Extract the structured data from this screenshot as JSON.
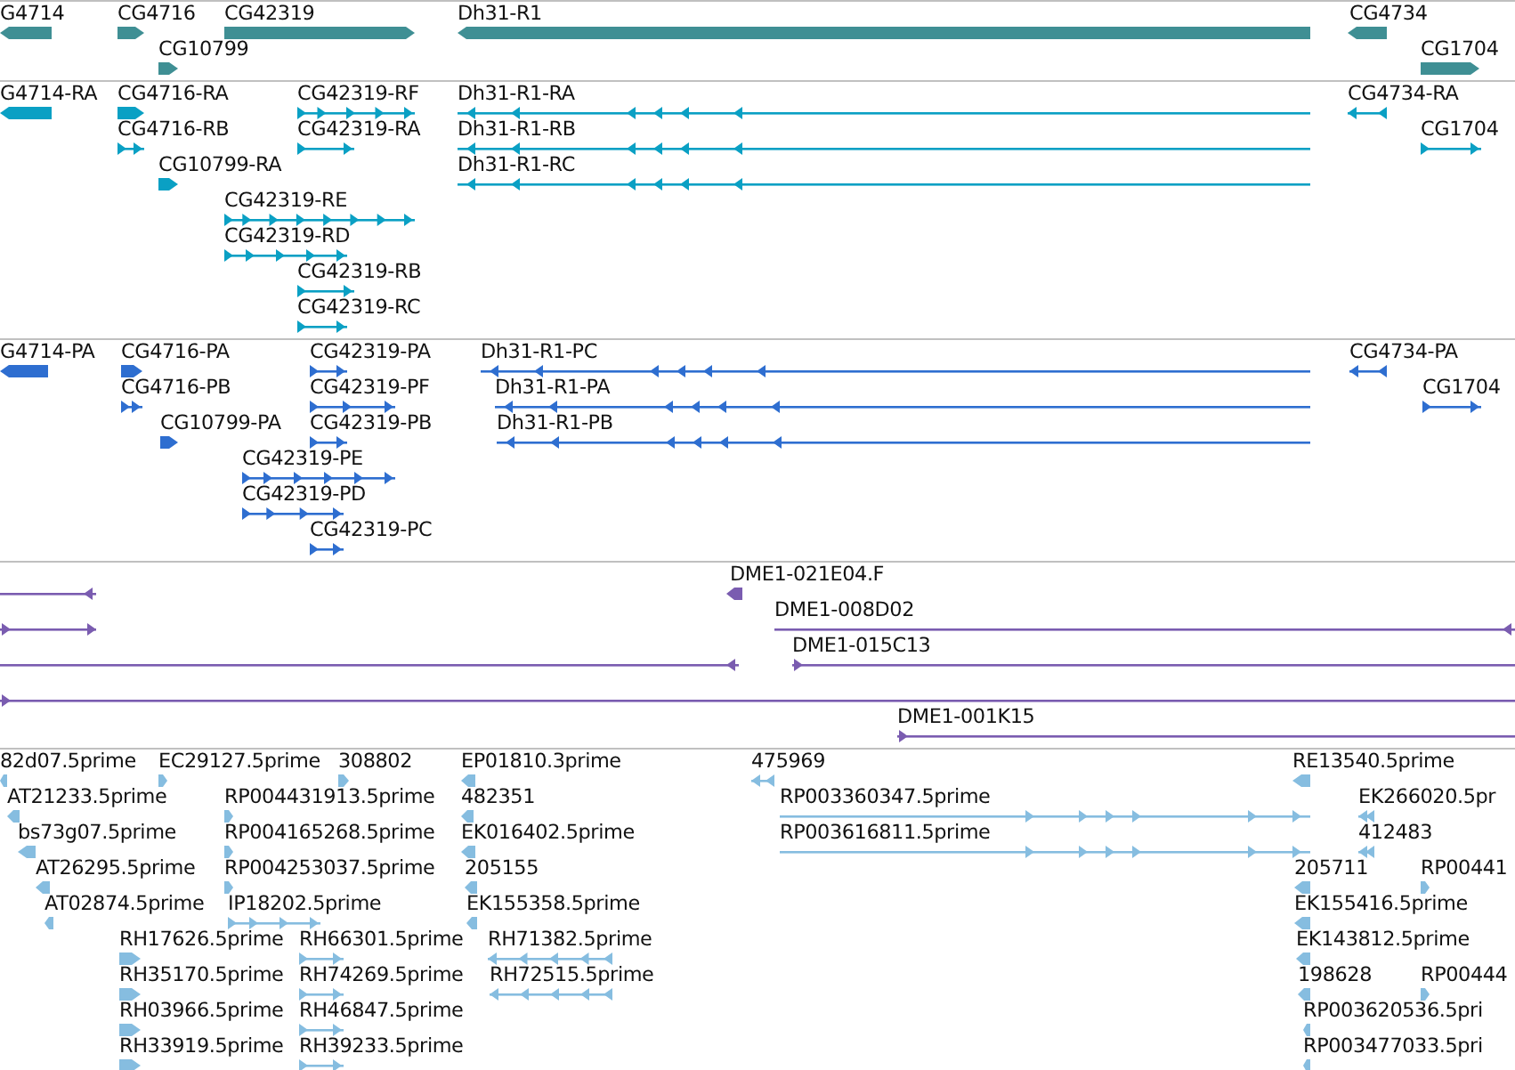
{
  "tracks": [
    {
      "color": "#3f8f94",
      "features": [
        {
          "label": "G4714",
          "kind": "block",
          "reverse": true
        },
        {
          "label": "CG4716",
          "kind": "block",
          "reverse": false
        },
        {
          "label": "CG42319",
          "kind": "block",
          "reverse": false
        },
        {
          "label": "Dh31-R1",
          "kind": "block",
          "reverse": true
        },
        {
          "label": "CG4734",
          "kind": "block",
          "reverse": true
        },
        {
          "label": "CG10799",
          "kind": "block",
          "reverse": false
        },
        {
          "label": "CG1704",
          "kind": "block",
          "reverse": false
        }
      ]
    },
    {
      "color": "#0aa0c4",
      "features": [
        {
          "label": "G4714-RA",
          "kind": "block",
          "reverse": true
        },
        {
          "label": "CG4716-RA",
          "kind": "block",
          "reverse": false
        },
        {
          "label": "CG42319-RF",
          "kind": "spliced",
          "reverse": false
        },
        {
          "label": "Dh31-R1-RA",
          "kind": "spliced",
          "reverse": true
        },
        {
          "label": "CG4734-RA",
          "kind": "spliced",
          "reverse": true
        },
        {
          "label": "CG4716-RB",
          "kind": "spliced",
          "reverse": false
        },
        {
          "label": "CG42319-RA",
          "kind": "spliced",
          "reverse": false
        },
        {
          "label": "Dh31-R1-RB",
          "kind": "spliced",
          "reverse": true
        },
        {
          "label": "CG1704",
          "kind": "spliced",
          "reverse": false
        },
        {
          "label": "CG10799-RA",
          "kind": "block",
          "reverse": false
        },
        {
          "label": "Dh31-R1-RC",
          "kind": "spliced",
          "reverse": true
        },
        {
          "label": "CG42319-RE",
          "kind": "spliced",
          "reverse": false
        },
        {
          "label": "CG42319-RD",
          "kind": "spliced",
          "reverse": false
        },
        {
          "label": "CG42319-RB",
          "kind": "spliced",
          "reverse": false
        },
        {
          "label": "CG42319-RC",
          "kind": "spliced",
          "reverse": false
        }
      ]
    },
    {
      "color": "#2e6ed0",
      "features": [
        {
          "label": "G4714-PA",
          "kind": "block",
          "reverse": true
        },
        {
          "label": "CG4716-PA",
          "kind": "block",
          "reverse": false
        },
        {
          "label": "CG42319-PA",
          "kind": "spliced",
          "reverse": false
        },
        {
          "label": "Dh31-R1-PC",
          "kind": "spliced",
          "reverse": true
        },
        {
          "label": "CG4734-PA",
          "kind": "spliced",
          "reverse": true
        },
        {
          "label": "CG4716-PB",
          "kind": "spliced",
          "reverse": false
        },
        {
          "label": "CG42319-PF",
          "kind": "spliced",
          "reverse": false
        },
        {
          "label": "Dh31-R1-PA",
          "kind": "spliced",
          "reverse": true
        },
        {
          "label": "CG1704",
          "kind": "spliced",
          "reverse": false
        },
        {
          "label": "CG10799-PA",
          "kind": "block",
          "reverse": false
        },
        {
          "label": "CG42319-PB",
          "kind": "spliced",
          "reverse": false
        },
        {
          "label": "Dh31-R1-PB",
          "kind": "spliced",
          "reverse": true
        },
        {
          "label": "CG42319-PE",
          "kind": "spliced",
          "reverse": false
        },
        {
          "label": "CG42319-PD",
          "kind": "spliced",
          "reverse": false
        },
        {
          "label": "CG42319-PC",
          "kind": "spliced",
          "reverse": false
        }
      ]
    },
    {
      "color": "#7a5cb0",
      "features": [
        {
          "kind": "clone",
          "reverse": true
        },
        {
          "label": "DME1-021E04.F",
          "kind": "block",
          "reverse": true
        },
        {
          "kind": "clone",
          "reverse": false
        },
        {
          "label": "DME1-008D02",
          "kind": "clone",
          "reverse": true
        },
        {
          "kind": "clone",
          "reverse": true
        },
        {
          "label": "DME1-015C13",
          "kind": "clone",
          "reverse": false
        },
        {
          "kind": "clone",
          "reverse": false
        },
        {
          "label": "DME1-001K15",
          "kind": "clone",
          "reverse": false
        }
      ]
    },
    {
      "color": "#86bde0",
      "features": [
        {
          "label": "82d07.5prime",
          "kind": "block",
          "reverse": true
        },
        {
          "label": "EC29127.5prime",
          "kind": "block",
          "reverse": false
        },
        {
          "label": "308802",
          "kind": "block",
          "reverse": false
        },
        {
          "label": "EP01810.3prime",
          "kind": "block",
          "reverse": true
        },
        {
          "label": "475969",
          "kind": "spliced",
          "reverse": true
        },
        {
          "label": "RE13540.5prime",
          "kind": "block",
          "reverse": true
        },
        {
          "label": "AT21233.5prime",
          "kind": "block",
          "reverse": true
        },
        {
          "label": "RP004431913.5prime",
          "kind": "block",
          "reverse": false
        },
        {
          "label": "482351",
          "kind": "block",
          "reverse": true
        },
        {
          "label": "RP003360347.5prime",
          "kind": "spliced",
          "reverse": false
        },
        {
          "label": "EK266020.5pr",
          "kind": "spliced",
          "reverse": true
        },
        {
          "label": "bs73g07.5prime",
          "kind": "block",
          "reverse": true
        },
        {
          "label": "RP004165268.5prime",
          "kind": "block",
          "reverse": false
        },
        {
          "label": "EK016402.5prime",
          "kind": "block",
          "reverse": true
        },
        {
          "label": "RP003616811.5prime",
          "kind": "spliced",
          "reverse": false
        },
        {
          "label": "412483",
          "kind": "spliced",
          "reverse": true
        },
        {
          "label": "AT26295.5prime",
          "kind": "block",
          "reverse": true
        },
        {
          "label": "RP004253037.5prime",
          "kind": "block",
          "reverse": false
        },
        {
          "label": "205155",
          "kind": "block",
          "reverse": true
        },
        {
          "label": "205711",
          "kind": "block",
          "reverse": true
        },
        {
          "label": "RP00441",
          "kind": "block",
          "reverse": false
        },
        {
          "label": "AT02874.5prime",
          "kind": "block",
          "reverse": true
        },
        {
          "label": "IP18202.5prime",
          "kind": "spliced",
          "reverse": false
        },
        {
          "label": "EK155358.5prime",
          "kind": "block",
          "reverse": true
        },
        {
          "label": "EK155416.5prime",
          "kind": "block",
          "reverse": true
        },
        {
          "label": "RH17626.5prime",
          "kind": "block",
          "reverse": false
        },
        {
          "label": "RH66301.5prime",
          "kind": "spliced",
          "reverse": false
        },
        {
          "label": "RH71382.5prime",
          "kind": "spliced",
          "reverse": true
        },
        {
          "label": "EK143812.5prime",
          "kind": "block",
          "reverse": true
        },
        {
          "label": "RH35170.5prime",
          "kind": "block",
          "reverse": false
        },
        {
          "label": "RH74269.5prime",
          "kind": "spliced",
          "reverse": false
        },
        {
          "label": "RH72515.5prime",
          "kind": "spliced",
          "reverse": true
        },
        {
          "label": "198628",
          "kind": "block",
          "reverse": true
        },
        {
          "label": "RP00444",
          "kind": "block",
          "reverse": false
        },
        {
          "label": "RH03966.5prime",
          "kind": "block",
          "reverse": false
        },
        {
          "label": "RH46847.5prime",
          "kind": "spliced",
          "reverse": false
        },
        {
          "label": "RP003620536.5pri",
          "kind": "block",
          "reverse": true
        },
        {
          "label": "RH33919.5prime",
          "kind": "block",
          "reverse": false
        },
        {
          "label": "RH39233.5prime",
          "kind": "spliced",
          "reverse": false
        },
        {
          "label": "RP003477033.5pri",
          "kind": "block",
          "reverse": true
        }
      ]
    }
  ]
}
